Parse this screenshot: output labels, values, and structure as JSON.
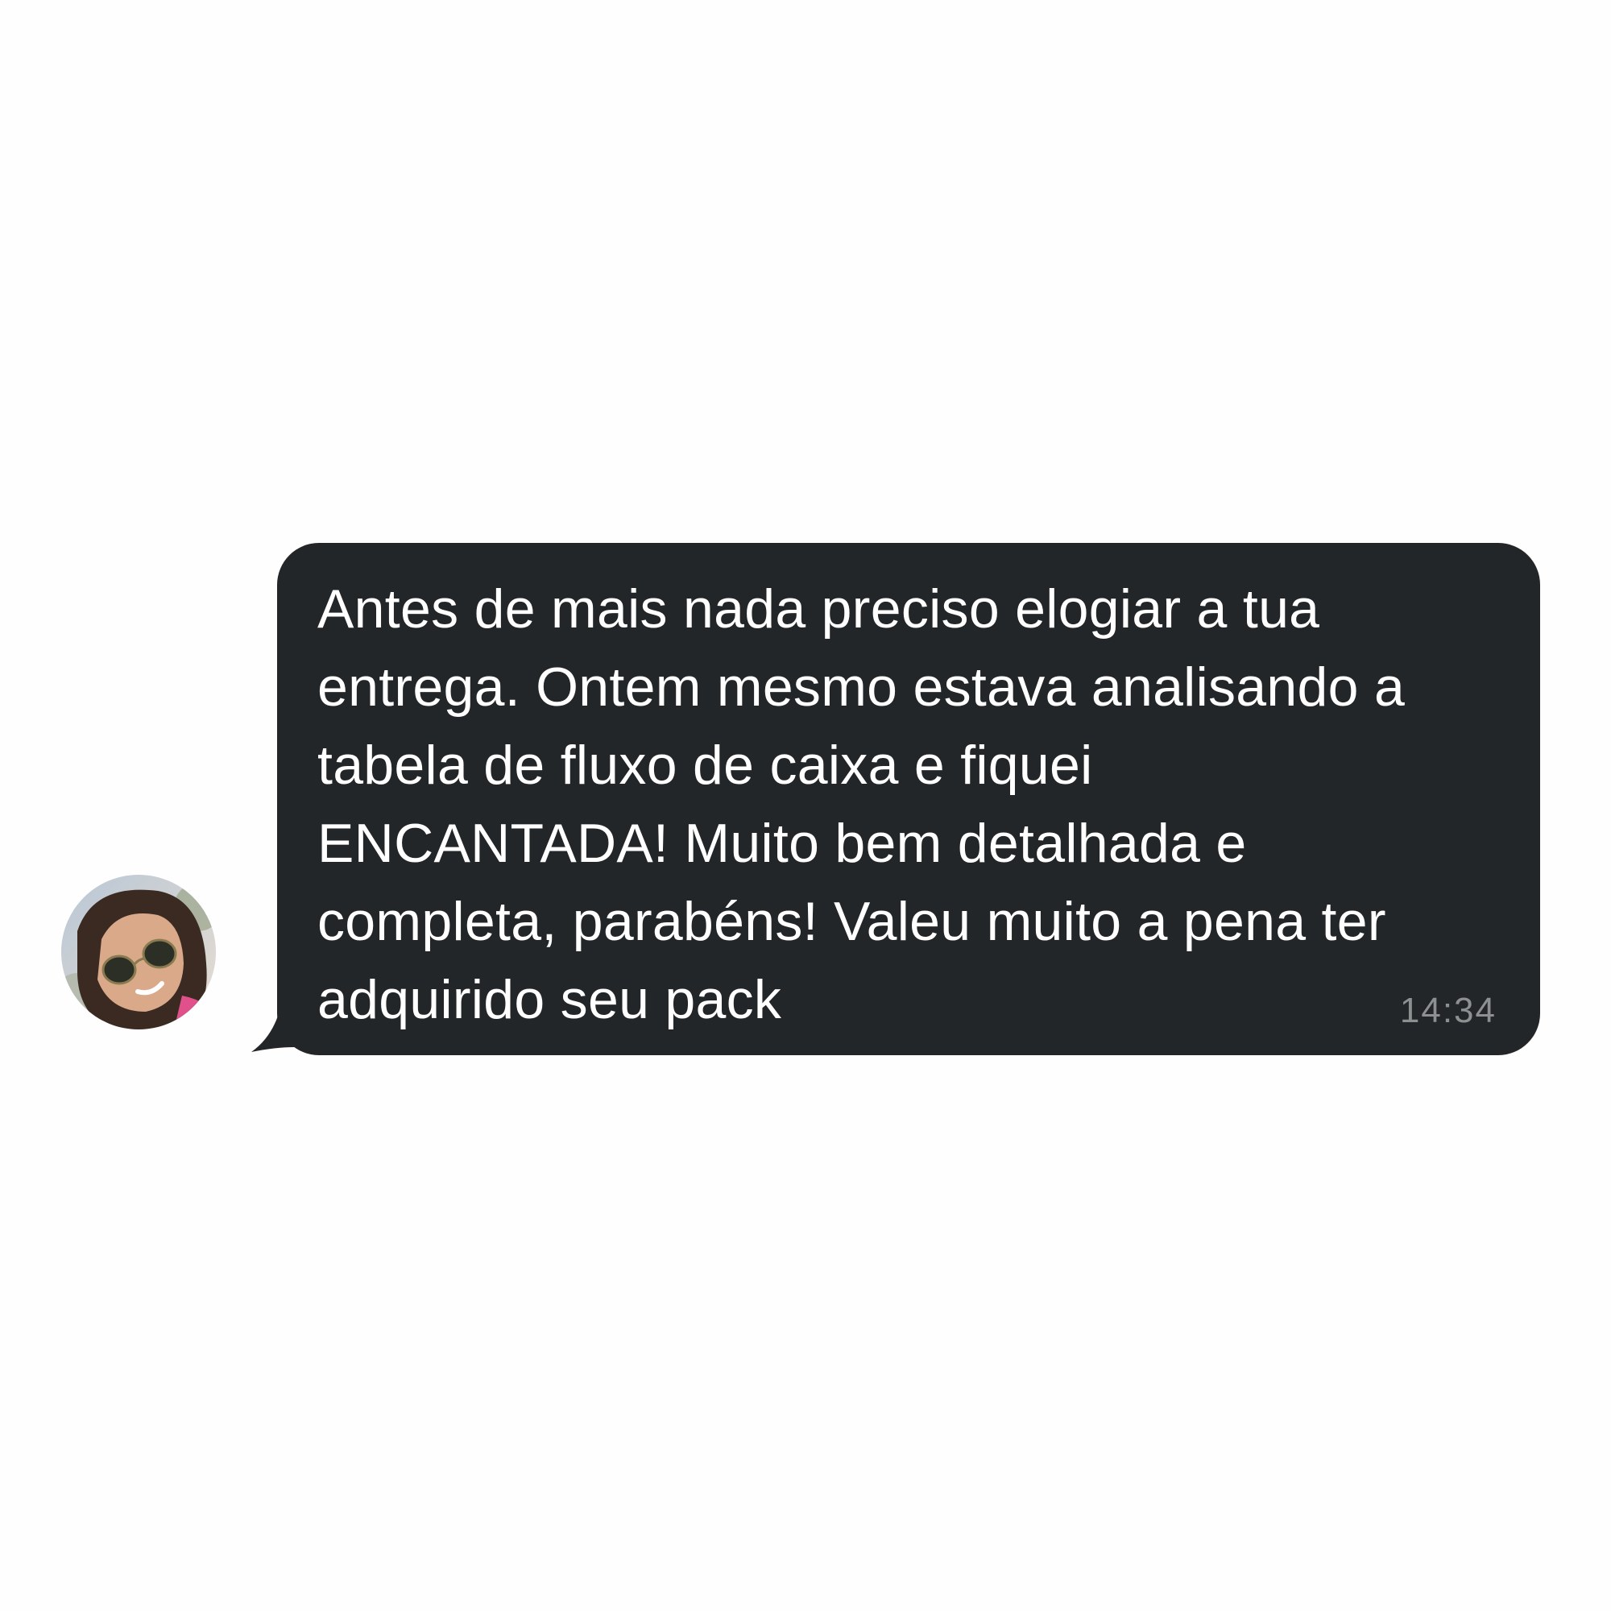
{
  "message": {
    "lines": [
      "Antes de mais nada preciso elogiar a tua",
      "entrega. Ontem mesmo estava analisando a",
      "tabela de fluxo de caixa e fiquei",
      "ENCANTADA! Muito bem detalhada e",
      "completa, parabéns! Valeu muito a pena ter",
      "adquirido seu pack"
    ],
    "timestamp": "14:34"
  },
  "colors": {
    "background": "#fefefe",
    "bubble": "#232628",
    "text": "#ffffff",
    "timestamp": "#8d8f91"
  },
  "avatar": {
    "icon": "user-photo-avatar"
  }
}
